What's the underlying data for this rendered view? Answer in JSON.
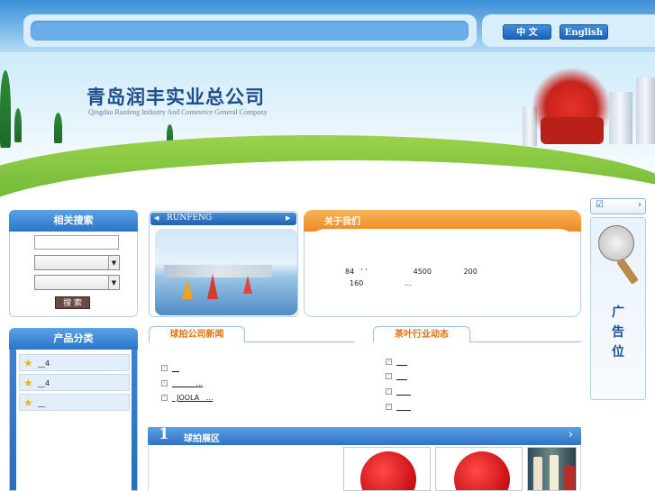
{
  "lang": {
    "chinese": "中 文",
    "english": "English"
  },
  "logo": {
    "cn": "青岛润丰实业总公司",
    "en": "Qingdao Runfeng Industry And Commerce General Company"
  },
  "search_panel": {
    "title": "相关搜索",
    "keyword_value": "",
    "button": "搜 索"
  },
  "slideshow": {
    "title": "RUNFENG",
    "prev": "◀",
    "next": "▶"
  },
  "about": {
    "title": "关于我们",
    "line1": "84   ' '                    4500              200",
    "line2": "160                  ..."
  },
  "categories": {
    "title": "产品分类",
    "items": [
      "__4",
      "__4",
      "__"
    ]
  },
  "news": {
    "title": "球拍公司新闻",
    "items": [
      "__",
      "______ ...",
      "  JOOLA   ..."
    ]
  },
  "industry": {
    "title": "茶叶行业动态",
    "items": [
      "___",
      "___",
      "____",
      "____"
    ]
  },
  "showcase": {
    "title": "球拍展区",
    "number": "1",
    "more": "›"
  },
  "ad": {
    "label": "广\n告\n位",
    "top_arrow": "›"
  },
  "colors": {
    "accent_blue": "#2c74c8",
    "accent_orange": "#ee8a22",
    "title_orange": "#e0720e"
  }
}
